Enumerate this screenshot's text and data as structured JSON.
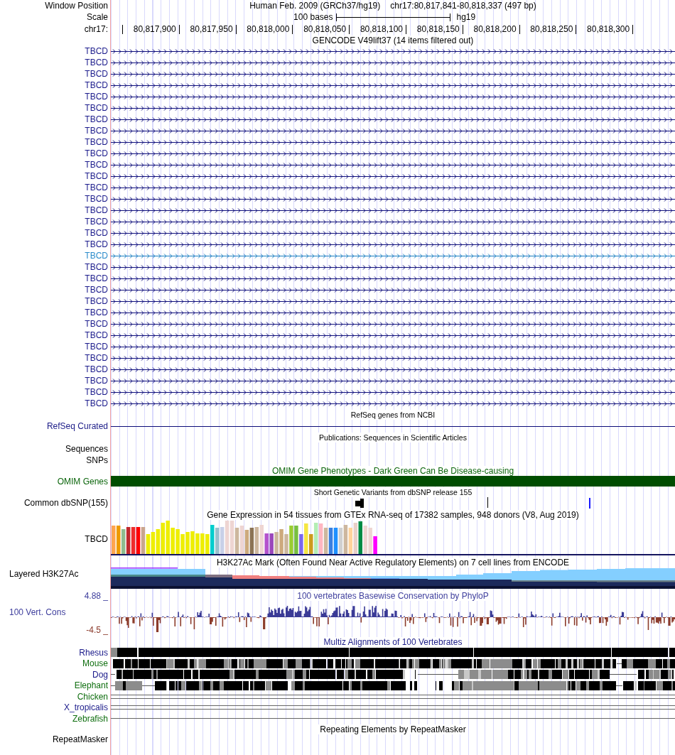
{
  "header": {
    "label": "Window Position",
    "assembly": "Human Feb. 2009 (GRCh37/hg19)",
    "position": "chr17:80,817,841-80,818,337 (497 bp)"
  },
  "scale": {
    "label": "Scale",
    "span": "100 bases",
    "genome": "hg19"
  },
  "ruler": {
    "label": "chr17:",
    "ticks": [
      "80,817,900",
      "80,817,950",
      "80,818,000",
      "80,818,050",
      "80,818,100",
      "80,818,150",
      "80,818,200",
      "80,818,250",
      "80,818,300"
    ]
  },
  "tracks": [
    {
      "kind": "genes",
      "title": "GENCODE V49lift37 (14 items filtered out)",
      "items": [
        {
          "label": "TBCD",
          "highlighted": false
        },
        {
          "label": "TBCD",
          "highlighted": false
        },
        {
          "label": "TBCD",
          "highlighted": false
        },
        {
          "label": "TBCD",
          "highlighted": false
        },
        {
          "label": "TBCD",
          "highlighted": false
        },
        {
          "label": "TBCD",
          "highlighted": false
        },
        {
          "label": "TBCD",
          "highlighted": false
        },
        {
          "label": "TBCD",
          "highlighted": false
        },
        {
          "label": "TBCD",
          "highlighted": false
        },
        {
          "label": "TBCD",
          "highlighted": false
        },
        {
          "label": "TBCD",
          "highlighted": false
        },
        {
          "label": "TBCD",
          "highlighted": false
        },
        {
          "label": "TBCD",
          "highlighted": false
        },
        {
          "label": "TBCD",
          "highlighted": false
        },
        {
          "label": "TBCD",
          "highlighted": false
        },
        {
          "label": "TBCD",
          "highlighted": false
        },
        {
          "label": "TBCD",
          "highlighted": false
        },
        {
          "label": "TBCD",
          "highlighted": false
        },
        {
          "label": "TBCD",
          "highlighted": true
        },
        {
          "label": "TBCD",
          "highlighted": false
        },
        {
          "label": "TBCD",
          "highlighted": false
        },
        {
          "label": "TBCD",
          "highlighted": false
        },
        {
          "label": "TBCD",
          "highlighted": false
        },
        {
          "label": "TBCD",
          "highlighted": false
        },
        {
          "label": "TBCD",
          "highlighted": false
        },
        {
          "label": "TBCD",
          "highlighted": false
        },
        {
          "label": "TBCD",
          "highlighted": false
        },
        {
          "label": "TBCD",
          "highlighted": false
        },
        {
          "label": "TBCD",
          "highlighted": false
        },
        {
          "label": "TBCD",
          "highlighted": false
        },
        {
          "label": "TBCD",
          "highlighted": false
        },
        {
          "label": "TBCD",
          "highlighted": false
        }
      ]
    },
    {
      "kind": "transcript",
      "title": "RefSeq genes from NCBI",
      "labels": [
        "RefSeq Curated"
      ]
    },
    {
      "kind": "articles",
      "title": "Publications: Sequences in Scientific Articles",
      "labels": [
        "Sequences",
        "SNPs"
      ]
    },
    {
      "kind": "phenotype",
      "title": "OMIM Gene Phenotypes - Dark Green Can Be Disease-causing",
      "labels": [
        "OMIM Genes"
      ]
    },
    {
      "kind": "variants",
      "title": "Short Genetic Variants from dbSNP release 155",
      "labels": [
        "Common dbSNP(155)"
      ]
    },
    {
      "kind": "expression",
      "title": "Gene Expression in 54 tissues from GTEx RNA-seq of 17382 samples, 948 donors (V8, Aug 2019)",
      "labels": [
        "TBCD"
      ]
    },
    {
      "kind": "layered",
      "title": "H3K27Ac Mark (Often Found Near Active Regulatory Elements) on 7 cell lines from ENCODE",
      "labels": [
        "Layered H3K27Ac"
      ]
    },
    {
      "kind": "conservation",
      "title": "100 vertebrates Basewise Conservation by PhyloP",
      "labels": [
        "100 Vert. Cons"
      ],
      "y_max_label": "4.88 _",
      "y_min_label": "-4.5 _"
    },
    {
      "kind": "alignment",
      "title": "Multiz Alignments of 100 Vertebrates",
      "species": [
        {
          "label": "Rhesus",
          "color": "#1a1a8a",
          "kind": "blocks"
        },
        {
          "label": "Mouse",
          "color": "#0f6e0f",
          "kind": "blocks"
        },
        {
          "label": "Dog",
          "color": "#1a1a8a",
          "kind": "blocks"
        },
        {
          "label": "Elephant",
          "color": "#0f6e0f",
          "kind": "blocks"
        },
        {
          "label": "Chicken",
          "color": "#0f6e0f",
          "kind": "double-line"
        },
        {
          "label": "X_tropicalis",
          "color": "#1a1a8a",
          "kind": "double-line"
        },
        {
          "label": "Zebrafish",
          "color": "#0f6e0f",
          "kind": "line"
        }
      ]
    },
    {
      "kind": "repeats",
      "title": "Repeating Elements by RepeatMasker",
      "labels": [
        "RepeatMasker"
      ]
    }
  ]
}
